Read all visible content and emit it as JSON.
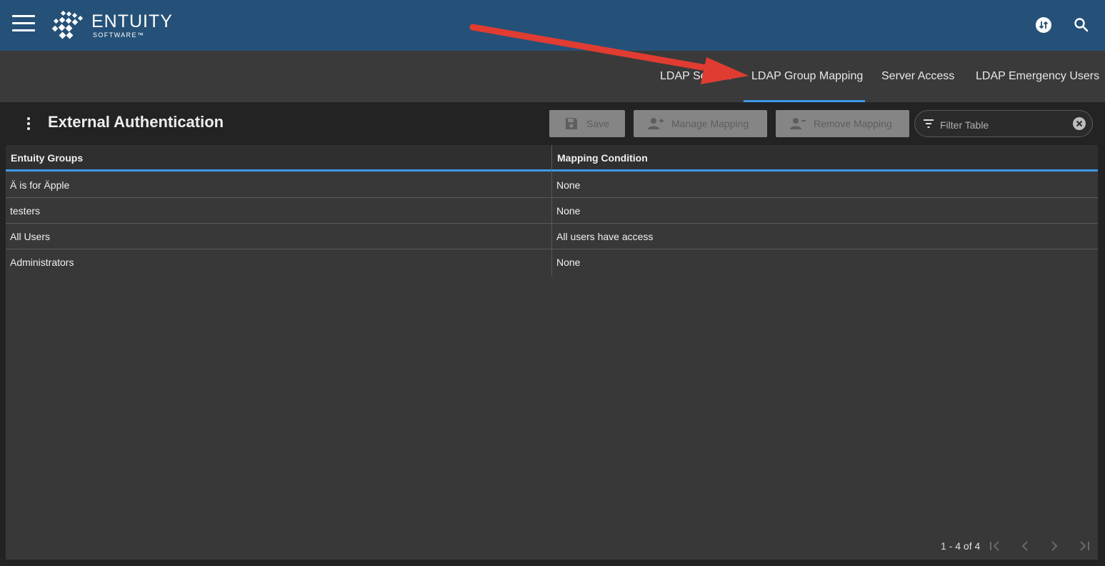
{
  "app": {
    "logo_text": "ENTUITY",
    "logo_sub": "SOFTWARE™"
  },
  "tabs": [
    {
      "label": "LDAP Servers",
      "active": false
    },
    {
      "label": "LDAP Group Mapping",
      "active": true
    },
    {
      "label": "Server Access",
      "active": false
    },
    {
      "label": "LDAP Emergency Users",
      "active": false
    }
  ],
  "panel": {
    "title": "External Authentication"
  },
  "toolbar": {
    "save_label": "Save",
    "manage_label": "Manage Mapping",
    "remove_label": "Remove Mapping",
    "filter_placeholder": "Filter Table"
  },
  "table": {
    "columns": [
      "Entuity Groups",
      "Mapping Condition"
    ],
    "rows": [
      {
        "group": "Ä is for Äpple",
        "condition": "None"
      },
      {
        "group": "testers",
        "condition": "None"
      },
      {
        "group": "All Users",
        "condition": "All users have access"
      },
      {
        "group": "Administrators",
        "condition": "None"
      }
    ]
  },
  "pagination": {
    "range_text": "1 - 4 of 4"
  },
  "colors": {
    "topbar": "#255178",
    "tab_bar": "#3a3a3a",
    "accent": "#3d9ae8",
    "annotation_arrow": "#e03c31"
  },
  "icons": [
    "menu-icon",
    "entuity-logo",
    "sync-icon",
    "search-icon",
    "more-vert-icon",
    "save-icon",
    "add-user-icon",
    "remove-user-icon",
    "filter-icon",
    "clear-icon",
    "first-page-icon",
    "prev-page-icon",
    "next-page-icon",
    "last-page-icon"
  ]
}
